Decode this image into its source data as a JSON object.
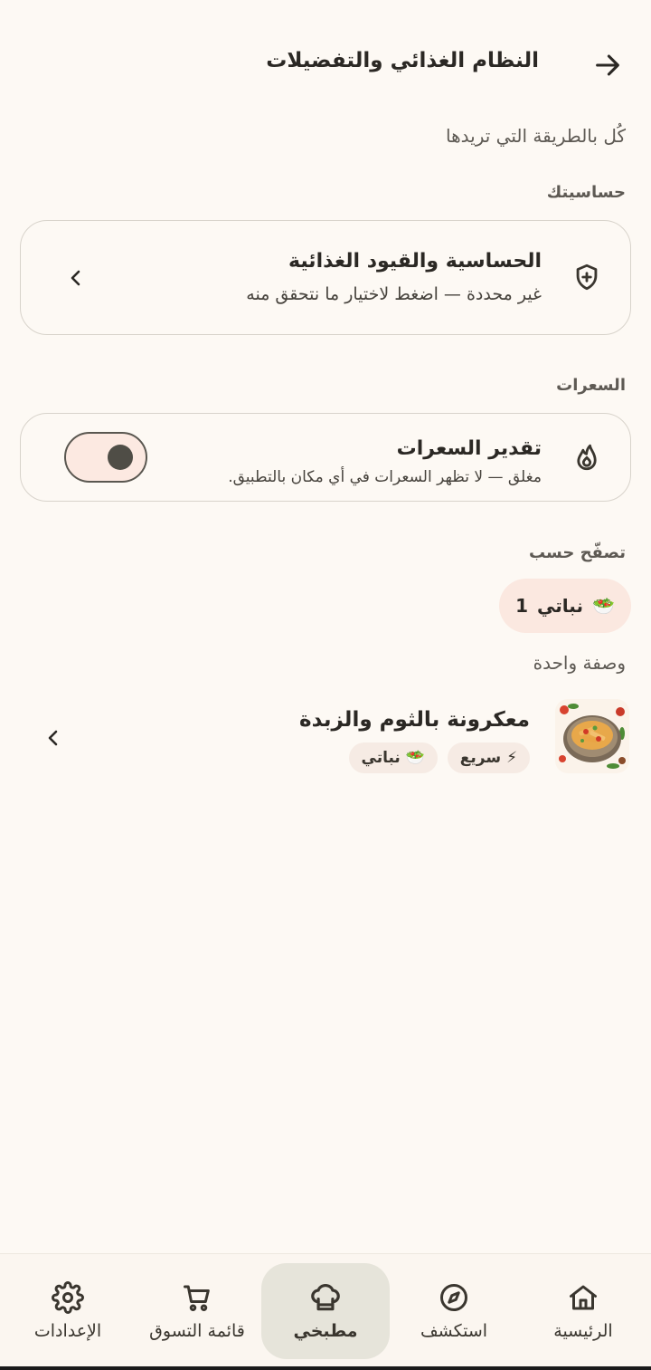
{
  "header": {
    "title": "النظام الغذائي والتفضيلات",
    "back_icon": "arrow-right-icon"
  },
  "subtitle": "كُل بالطريقة التي تريدها",
  "allergies_section": {
    "label": "حساسيتك",
    "card": {
      "title": "الحساسية والقيود الغذائية",
      "description": "غير محددة — اضغط لاختيار ما نتحقق منه",
      "icon": "shield-plus-icon"
    }
  },
  "calories_section": {
    "label": "السعرات",
    "card": {
      "title": "تقدير السعرات",
      "description": "مغلق — لا تظهر السعرات في أي مكان بالتطبيق.",
      "icon": "flame-icon",
      "toggle_on": false
    }
  },
  "browse_section": {
    "label": "تصفّح حسب",
    "chip": {
      "emoji": "🥗",
      "label": "نباتي",
      "count": "1"
    }
  },
  "recipes": {
    "count_label": "وصفة واحدة",
    "items": [
      {
        "title": "معكرونة بالثوم والزبدة",
        "tags": [
          {
            "emoji": "⚡",
            "label": "سريع"
          },
          {
            "emoji": "🥗",
            "label": "نباتي"
          }
        ]
      }
    ]
  },
  "bottom_nav": {
    "items": [
      {
        "label": "الرئيسية",
        "icon": "home-icon",
        "active": false
      },
      {
        "label": "استكشف",
        "icon": "compass-icon",
        "active": false
      },
      {
        "label": "مطبخي",
        "icon": "chef-hat-icon",
        "active": true
      },
      {
        "label": "قائمة التسوق",
        "icon": "cart-icon",
        "active": false
      },
      {
        "label": "الإعدادات",
        "icon": "gear-icon",
        "active": false
      }
    ]
  },
  "colors": {
    "background": "#fdf9f4",
    "chip_bg": "#fbe8e0",
    "active_nav_bg": "#e6e4da",
    "text": "#2b2824"
  }
}
